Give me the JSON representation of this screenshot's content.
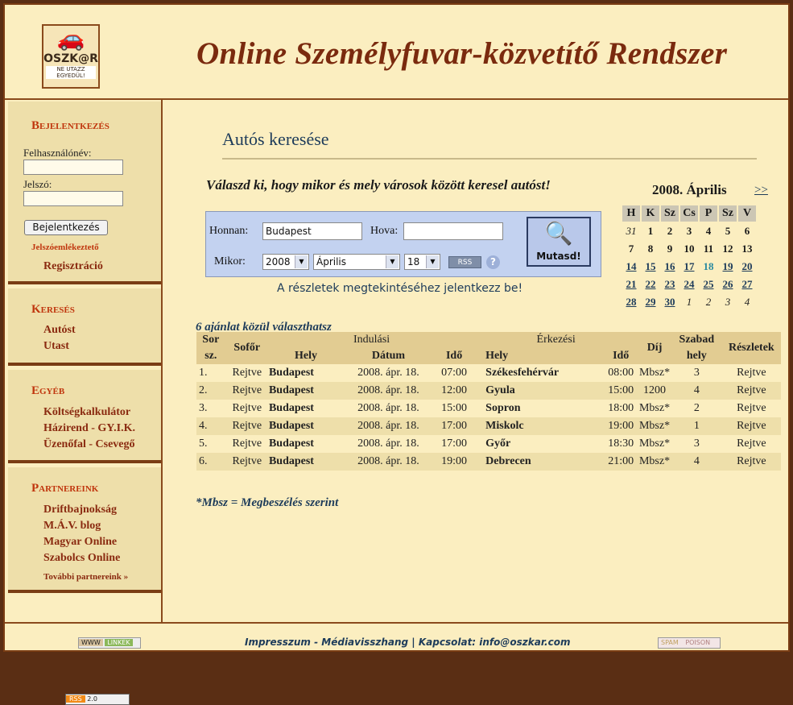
{
  "header": {
    "logo_text": "OSZK@R",
    "logo_tagline": "NE UTAZZ EGYEDÜL!",
    "site_title": "Online Személyfuvar-közvetítő Rendszer"
  },
  "sidebar": {
    "login": {
      "heading": "Bejelentkezés",
      "username_label": "Felhasználónév:",
      "password_label": "Jelszó:",
      "login_button": "Bejelentkezés",
      "password_reminder": "Jelszóemlékeztető",
      "register": "Regisztráció"
    },
    "search": {
      "heading": "Keresés",
      "items": [
        "Autóst",
        "Utast"
      ]
    },
    "other": {
      "heading": "Egyéb",
      "items": [
        "Költségkalkulátor",
        "Házirend - GY.I.K.",
        "Üzenőfal - Csevegő"
      ]
    },
    "partners": {
      "heading": "Partnereink",
      "items": [
        "Driftbajnokság",
        "M.Á.V. blog",
        "Magyar Online",
        "Szabolcs Online"
      ],
      "more": "További partnereink »"
    },
    "rss_badge": {
      "left": "RSS",
      "right": "2.0"
    }
  },
  "main": {
    "title": "Autós keresése",
    "lead": "Válaszd ki, hogy mikor és mely városok között keresel autóst!",
    "form": {
      "from_label": "Honnan:",
      "from_value": "Budapest",
      "to_label": "Hova:",
      "to_value": "",
      "when_label": "Mikor:",
      "year": "2008",
      "month": "Április",
      "day": "18",
      "rss_label": "RSS",
      "help_label": "?",
      "show_button": "Mutasd!"
    },
    "login_hint": "A részletek megtekintéséhez jelentkezz be!",
    "result_count": "6 ajánlat közül választhatsz",
    "table": {
      "headers": {
        "sor": "Sor",
        "sz": "sz.",
        "driver": "Sofőr",
        "departure": "Indulási",
        "arrival": "Érkezési",
        "place": "Hely",
        "date": "Dátum",
        "time": "Idő",
        "fee": "Díj",
        "free1": "Szabad",
        "free2": "hely",
        "details": "Részletek"
      },
      "rows": [
        {
          "n": "1.",
          "driver": "Rejtve",
          "from": "Budapest",
          "date": "2008. ápr. 18.",
          "dep": "07:00",
          "to": "Székesfehérvár",
          "arr": "08:00",
          "fee": "Mbsz*",
          "seats": "3",
          "details": "Rejtve"
        },
        {
          "n": "2.",
          "driver": "Rejtve",
          "from": "Budapest",
          "date": "2008. ápr. 18.",
          "dep": "12:00",
          "to": "Gyula",
          "arr": "15:00",
          "fee": "1200",
          "seats": "4",
          "details": "Rejtve"
        },
        {
          "n": "3.",
          "driver": "Rejtve",
          "from": "Budapest",
          "date": "2008. ápr. 18.",
          "dep": "15:00",
          "to": "Sopron",
          "arr": "18:00",
          "fee": "Mbsz*",
          "seats": "2",
          "details": "Rejtve"
        },
        {
          "n": "4.",
          "driver": "Rejtve",
          "from": "Budapest",
          "date": "2008. ápr. 18.",
          "dep": "17:00",
          "to": "Miskolc",
          "arr": "19:00",
          "fee": "Mbsz*",
          "seats": "1",
          "details": "Rejtve"
        },
        {
          "n": "5.",
          "driver": "Rejtve",
          "from": "Budapest",
          "date": "2008. ápr. 18.",
          "dep": "17:00",
          "to": "Győr",
          "arr": "18:30",
          "fee": "Mbsz*",
          "seats": "3",
          "details": "Rejtve"
        },
        {
          "n": "6.",
          "driver": "Rejtve",
          "from": "Budapest",
          "date": "2008. ápr. 18.",
          "dep": "19:00",
          "to": "Debrecen",
          "arr": "21:00",
          "fee": "Mbsz*",
          "seats": "4",
          "details": "Rejtve"
        }
      ]
    },
    "footnote": "*Mbsz = Megbeszélés szerint"
  },
  "calendar": {
    "title": "2008. Április",
    "next": ">>",
    "weekdays": [
      "H",
      "K",
      "Sz",
      "Cs",
      "P",
      "Sz",
      "V"
    ],
    "weeks": [
      [
        {
          "d": "31",
          "t": "other"
        },
        {
          "d": "1",
          "t": "past"
        },
        {
          "d": "2",
          "t": "past"
        },
        {
          "d": "3",
          "t": "past"
        },
        {
          "d": "4",
          "t": "past"
        },
        {
          "d": "5",
          "t": "past"
        },
        {
          "d": "6",
          "t": "past"
        }
      ],
      [
        {
          "d": "7",
          "t": "past"
        },
        {
          "d": "8",
          "t": "past"
        },
        {
          "d": "9",
          "t": "past"
        },
        {
          "d": "10",
          "t": "past"
        },
        {
          "d": "11",
          "t": "past"
        },
        {
          "d": "12",
          "t": "past"
        },
        {
          "d": "13",
          "t": "past"
        }
      ],
      [
        {
          "d": "14",
          "t": "link"
        },
        {
          "d": "15",
          "t": "link"
        },
        {
          "d": "16",
          "t": "link"
        },
        {
          "d": "17",
          "t": "link"
        },
        {
          "d": "18",
          "t": "today"
        },
        {
          "d": "19",
          "t": "link"
        },
        {
          "d": "20",
          "t": "link"
        }
      ],
      [
        {
          "d": "21",
          "t": "link"
        },
        {
          "d": "22",
          "t": "link"
        },
        {
          "d": "23",
          "t": "link"
        },
        {
          "d": "24",
          "t": "link"
        },
        {
          "d": "25",
          "t": "link"
        },
        {
          "d": "26",
          "t": "link"
        },
        {
          "d": "27",
          "t": "link"
        }
      ],
      [
        {
          "d": "28",
          "t": "link"
        },
        {
          "d": "29",
          "t": "link"
        },
        {
          "d": "30",
          "t": "link"
        },
        {
          "d": "1",
          "t": "other"
        },
        {
          "d": "2",
          "t": "other"
        },
        {
          "d": "3",
          "t": "other"
        },
        {
          "d": "4",
          "t": "other"
        }
      ]
    ]
  },
  "footer": {
    "links": "Impresszum - Médiavisszhang    |    Kapcsolat: info@oszkar.com",
    "badge_left": {
      "a": "WWW",
      "b": "LINKEK"
    },
    "badge_right": {
      "a": "SPAM",
      "b": "POISON"
    }
  }
}
